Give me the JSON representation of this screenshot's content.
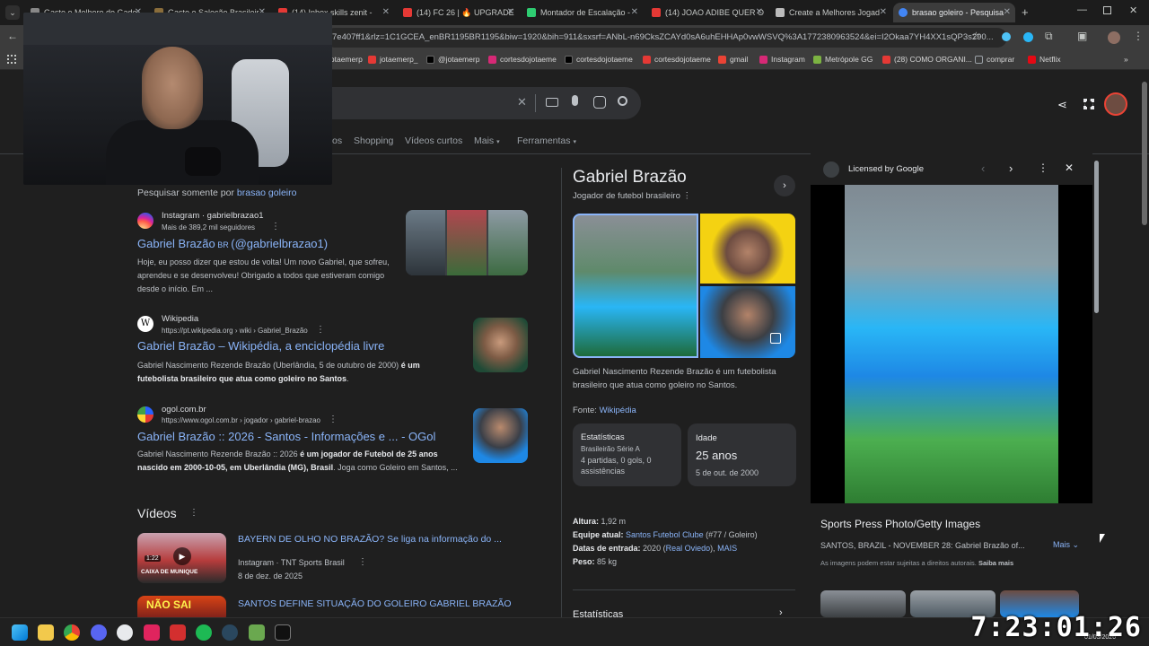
{
  "tabs": [
    {
      "title": "Gaste o Melhore do Gade",
      "color": "#888888"
    },
    {
      "title": "Gaste e Saleção Brasileir",
      "color": "#8a6d3b"
    },
    {
      "title": "(14) Inbox skills zenit - ",
      "color": "#e53935"
    },
    {
      "title": "(14) FC 26 | 🔥 UPGRADE",
      "color": "#e53935"
    },
    {
      "title": "Montador de Escalação - ",
      "color": "#2ecc71"
    },
    {
      "title": "(14) JOAO ADIBE QUER O",
      "color": "#e53935"
    },
    {
      "title": "Create a Melhores Jogad",
      "color": "#bbbbbb"
    },
    {
      "title": "brasao goleiro - Pesquisa",
      "color": "#4285f4"
    }
  ],
  "address": {
    "url": "7e407ff1&rlz=1C1GCEA_enBR1195BR1195&biw=1920&bih=911&sxsrf=ANbL-n69CksZCAYd0sA6uhEHHAp0vwWSVQ%3A1772380963524&ei=I2Okaa7YH4XX1sQP3s290..."
  },
  "bookmarks": [
    {
      "label": "jotaemerp",
      "color": "#e53935"
    },
    {
      "label": "jotaemerp_",
      "color": "#e53935"
    },
    {
      "label": "@jotaemerp",
      "color": "#000000"
    },
    {
      "label": "cortesdojotaeme",
      "color": "#d62976"
    },
    {
      "label": "cortesdojotaeme",
      "color": "#000000"
    },
    {
      "label": "cortesdojotaeme",
      "color": "#e53935"
    },
    {
      "label": "gmail",
      "color": "#ea4335"
    },
    {
      "label": "Instagram",
      "color": "#d62976"
    },
    {
      "label": "Metrópole GG",
      "color": "#7cb342"
    },
    {
      "label": "(28) COMO ORGANI...",
      "color": "#e53935"
    },
    {
      "label": "comprar",
      "color": "#9aa0a6"
    },
    {
      "label": "Netflix",
      "color": "#e50914"
    }
  ],
  "search_nav": {
    "tabs": [
      "os",
      "Shopping",
      "Vídeos curtos",
      "Mais",
      "Ferramentas"
    ]
  },
  "filter_text": "Pesquisar somente por",
  "filter_link": "brasao goleiro",
  "results": [
    {
      "source": "Instagram · gabrielbrazao1",
      "url": "Mais de 389,2 mil seguidores",
      "title": "Gabriel Brazão",
      "title_extra": " BR ",
      "title_tail": "(@gabrielbrazao1)",
      "snippet": "Hoje, eu posso dizer que estou de volta! Um novo Gabriel, que sofreu, aprendeu e se desenvolveu! Obrigado a todos que estiveram comigo desde o início. Em ..."
    },
    {
      "source": "Wikipedia",
      "url": "https://pt.wikipedia.org › wiki › Gabriel_Brazão",
      "title": "Gabriel Brazão – Wikipédia, a enciclopédia livre",
      "snippet_plain": "Gabriel Nascimento Rezende Brazão (Uberlândia, 5 de outubro de 2000) ",
      "snippet_bold": "é um futebolista brasileiro que atua como goleiro no Santos",
      "snippet_end": "."
    },
    {
      "source": "ogol.com.br",
      "url": "https://www.ogol.com.br › jogador › gabriel-brazao",
      "title": "Gabriel Brazão :: 2026 - Santos - Informações e ... - OGol",
      "snippet_plain": "Gabriel Nascimento Rezende Brazão :: 2026 ",
      "snippet_bold": "é um jogador de Futebol de 25 anos nascido em 2000-10-05, em Uberlândia (MG), Brasil",
      "snippet_end": ". Joga como Goleiro em Santos, ..."
    }
  ],
  "videos": {
    "heading": "Vídeos",
    "items": [
      {
        "title": "BAYERN DE OLHO NO BRAZÃO? Se liga na informação do ...",
        "meta": "Instagram · TNT Sports Brasil",
        "date": "8 de dez. de 2025",
        "duration": "1:22",
        "thumb_text": "CAIXA DE MUNIQUE"
      },
      {
        "title": "SANTOS DEFINE SITUAÇÃO DO GOLEIRO GABRIEL BRAZÃO",
        "thumb_text": "NÃO SAI"
      }
    ]
  },
  "knowledge_panel": {
    "name": "Gabriel Brazão",
    "subtitle": "Jogador de futebol brasileiro",
    "description": "Gabriel Nascimento Rezende Brazão é um futebolista brasileiro que atua como goleiro no Santos.",
    "source_label": "Fonte:",
    "source_link": "Wikipédia",
    "stats_card": {
      "title": "Estatísticas",
      "sub": "Brasileirão Série A",
      "text": "4 partidas, 0 gols, 0 assistências"
    },
    "age_card": {
      "title": "Idade",
      "value": "25 anos",
      "sub": "5 de out. de 2000"
    },
    "facts": [
      {
        "label": "Altura:",
        "value": "1,92 m"
      },
      {
        "label": "Equipe atual:",
        "link": "Santos Futebol Clube",
        "value": " (#77 / Goleiro)"
      },
      {
        "label": "Datas de entrada:",
        "value": "2020 (",
        "link": "Real Oviedo",
        "tail": "), ",
        "link2": "MAIS"
      },
      {
        "label": "Peso:",
        "value": "85 kg"
      }
    ],
    "next_section": "Estatísticas"
  },
  "preview": {
    "license": "Licensed by Google",
    "source": "Sports Press Photo/Getty Images",
    "caption": "SANTOS, BRAZIL - NOVEMBER 28: Gabriel Brazão of...",
    "more": "Mais",
    "rights": "As imagens podem estar sujeitas a direitos autorais.",
    "rights_link": "Saiba mais"
  },
  "clock": "7:23:01:26",
  "tray_date": "01/03/2026"
}
